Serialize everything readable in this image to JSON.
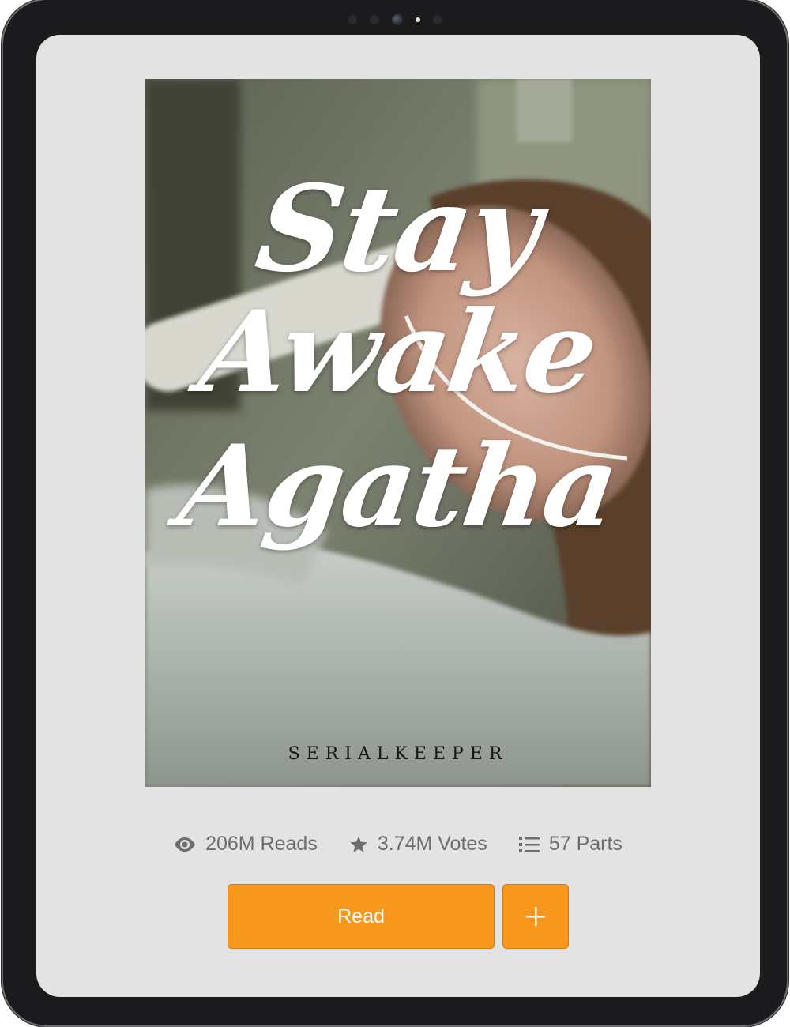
{
  "cover": {
    "title_line_1": "Stay",
    "title_line_2": "Awake",
    "title_line_3": "Agatha",
    "author": "SERIALKEEPER"
  },
  "stats": {
    "reads": "206M Reads",
    "votes": "3.74M Votes",
    "parts": "57 Parts",
    "reads_icon": "eye-icon",
    "votes_icon": "star-icon",
    "parts_icon": "list-icon"
  },
  "actions": {
    "read_label": "Read",
    "add_icon": "plus-icon"
  },
  "colors": {
    "accent": "#f7981d",
    "screen_bg": "#e3e3e3",
    "stat_text": "#6e6e6e"
  }
}
